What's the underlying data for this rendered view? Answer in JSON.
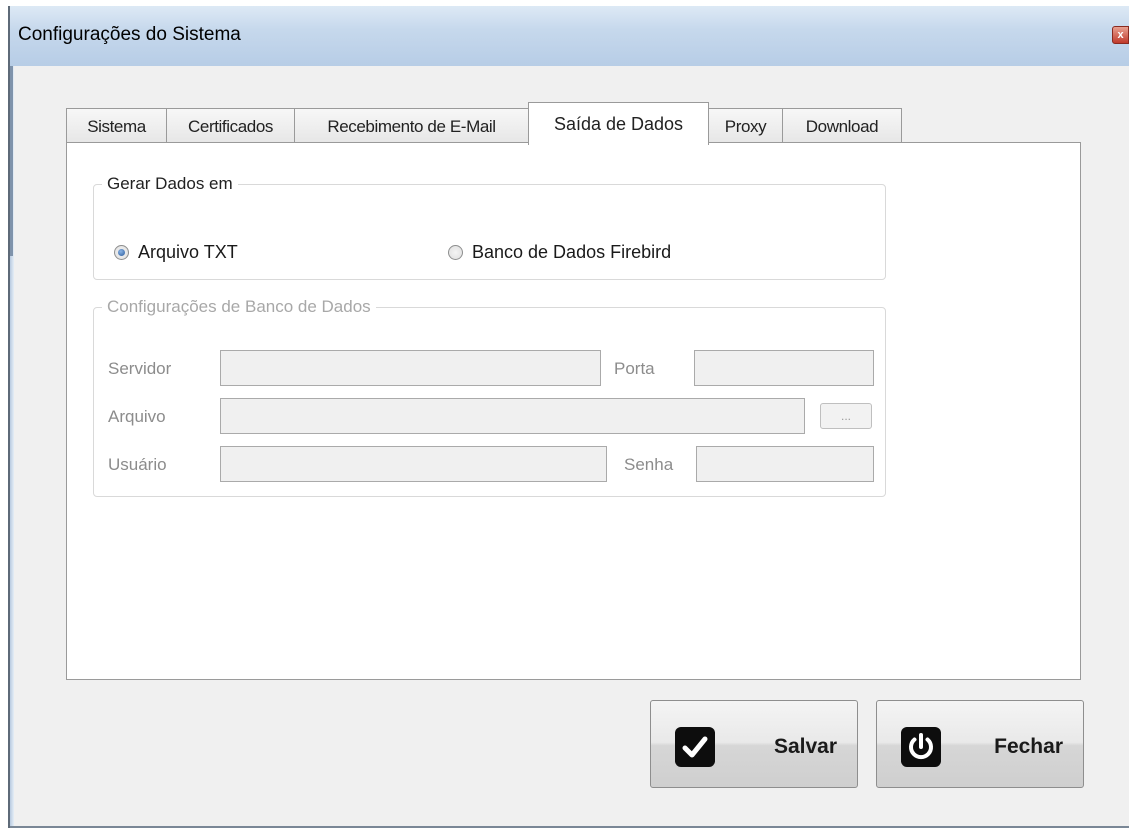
{
  "window": {
    "title": "Configurações do Sistema",
    "close_glyph": "x"
  },
  "tabs": [
    {
      "label": "Sistema",
      "active": false
    },
    {
      "label": "Certificados",
      "active": false
    },
    {
      "label": "Recebimento de E-Mail",
      "active": false
    },
    {
      "label": "Saída de Dados",
      "active": true
    },
    {
      "label": "Proxy",
      "active": false
    },
    {
      "label": "Download",
      "active": false
    }
  ],
  "output_group": {
    "legend": "Gerar Dados em",
    "options": [
      {
        "label": "Arquivo TXT",
        "selected": true
      },
      {
        "label": "Banco de Dados Firebird",
        "selected": false
      }
    ]
  },
  "db_group": {
    "legend": "Configurações de Banco de Dados",
    "enabled": false,
    "fields": {
      "servidor_label": "Servidor",
      "servidor_value": "",
      "porta_label": "Porta",
      "porta_value": "",
      "arquivo_label": "Arquivo",
      "arquivo_value": "",
      "usuario_label": "Usuário",
      "usuario_value": "",
      "senha_label": "Senha",
      "senha_value": ""
    },
    "browse_label": "..."
  },
  "buttons": {
    "save": {
      "label": "Salvar",
      "icon": "checkmark-icon"
    },
    "close": {
      "label": "Fechar",
      "icon": "power-icon"
    }
  },
  "colors": {
    "titlebar": "#c6d8ec",
    "close_button": "#c0392b",
    "disabled_text": "#8c8c8c"
  }
}
